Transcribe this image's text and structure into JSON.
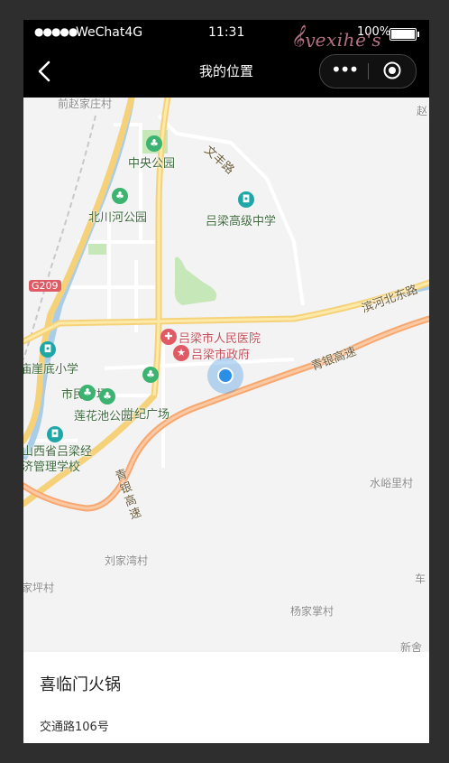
{
  "status": {
    "signal": "●●●●●",
    "carrier": "WeChat4G",
    "time": "11:31",
    "battery": "100%"
  },
  "nav": {
    "title": "我的位置",
    "menu": "•••"
  },
  "watermark": {
    "text": "yexihe's blog",
    "clef": "𝄞"
  },
  "map": {
    "labels": {
      "north_village": "前赵家庄村",
      "zhao": "赵",
      "central_park": "中央公园",
      "wenfeng_road": "文丰路",
      "beichuan_park": "北川河公园",
      "lvliang_high": "吕梁高级中学",
      "g209": "G209",
      "binhe_road": "滨河北东路",
      "hospital": "吕梁市人民医院",
      "yaidi_school": "庙崖底小学",
      "city_gov": "吕梁市政府",
      "qingyin_highway": "青银高速",
      "civic_square": "市民广场",
      "century_square": "世纪广场",
      "lotus_park": "莲花池公园",
      "economic_school": "山西省吕梁经济管理学校",
      "qingyin_highway2": "青银高速",
      "shuiyu_village": "水峪里村",
      "liujiawan": "刘家湾村",
      "jiaping": "家坪村",
      "che": "车",
      "yangjiazhang": "杨家掌村",
      "xinyu": "新舍"
    }
  },
  "place": {
    "name": "喜临门火锅",
    "address": "交通路106号"
  }
}
